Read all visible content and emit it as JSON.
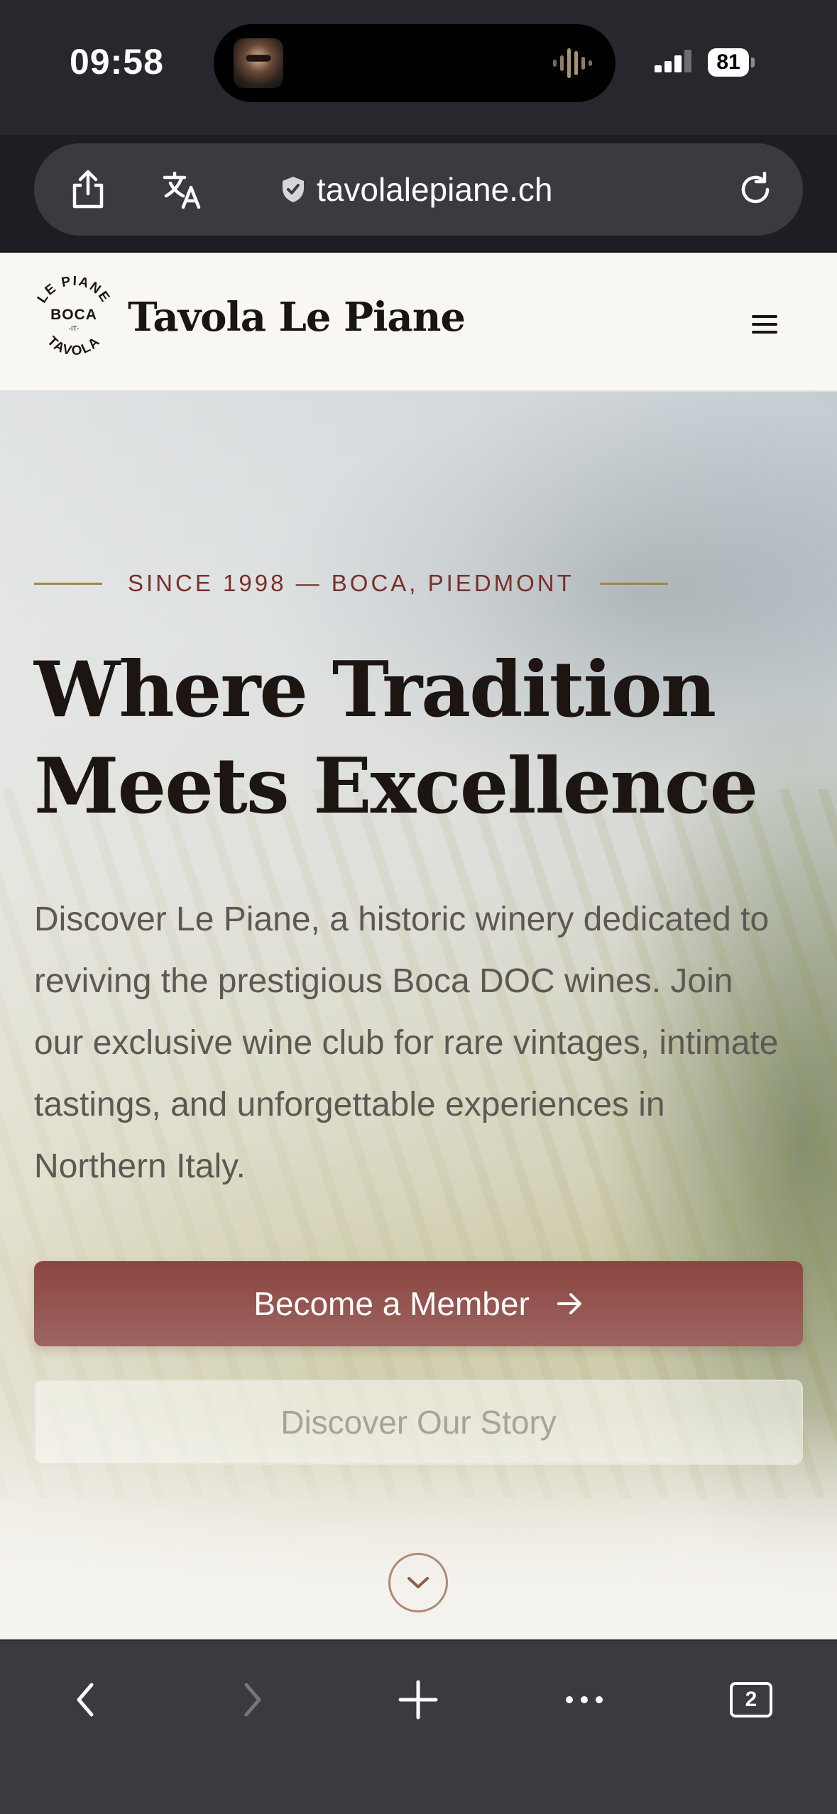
{
  "status_bar": {
    "time": "09:58",
    "battery": "81",
    "icons": [
      "now-playing-thumbnail",
      "audio-waveform-icon",
      "cellular-signal-icon",
      "battery-icon"
    ]
  },
  "browser": {
    "url": "tavolalepiane.ch",
    "url_bar_icons": [
      "share-icon",
      "translate-icon",
      "shield-icon",
      "reload-icon"
    ],
    "toolbar_icons": [
      "back-icon",
      "forward-icon",
      "plus-icon",
      "more-icon",
      "tabs-icon"
    ],
    "tab_count": "2"
  },
  "site_header": {
    "logo_text": [
      "LE PIANE",
      "BOCA",
      "-IT-",
      "TAVOLA"
    ],
    "site_name": "Tavola Le Piane",
    "menu_icon": "hamburger-menu-icon"
  },
  "hero": {
    "eyebrow": "SINCE 1998 — BOCA, PIEDMONT",
    "title_line_1": "Where Tradition",
    "title_line_2": "Meets Excellence",
    "description": "Discover Le Piane, a historic winery dedicated to reviving the prestigious Boca DOC wines. Join our exclusive wine club for rare vintages, intimate tastings, and unforgettable experiences in Northern Italy.",
    "primary_cta": "Become a Member",
    "secondary_cta": "Discover Our Story",
    "scroll_icon": "chevron-down-icon"
  },
  "colors": {
    "burgundy": "#8b4540",
    "gold_line": "#a08348",
    "eyebrow_text": "#7a2f2b",
    "heading": "#1c1512",
    "body_text": "#5e5853",
    "browser_chrome": "#3a3a40"
  }
}
